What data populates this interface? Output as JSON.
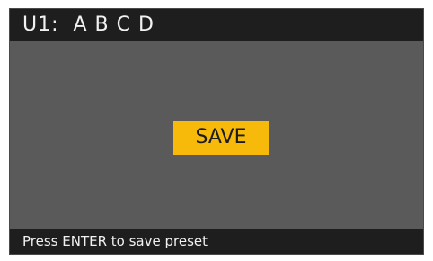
{
  "header": {
    "title": "U1:  A B C D"
  },
  "main": {
    "save_label": "SAVE"
  },
  "footer": {
    "hint": "Press ENTER to save preset"
  },
  "colors": {
    "screen_bg": "#5a5a5a",
    "bar_bg": "#1e1e1e",
    "accent": "#f7ba0b",
    "text": "#f2f2f2"
  }
}
